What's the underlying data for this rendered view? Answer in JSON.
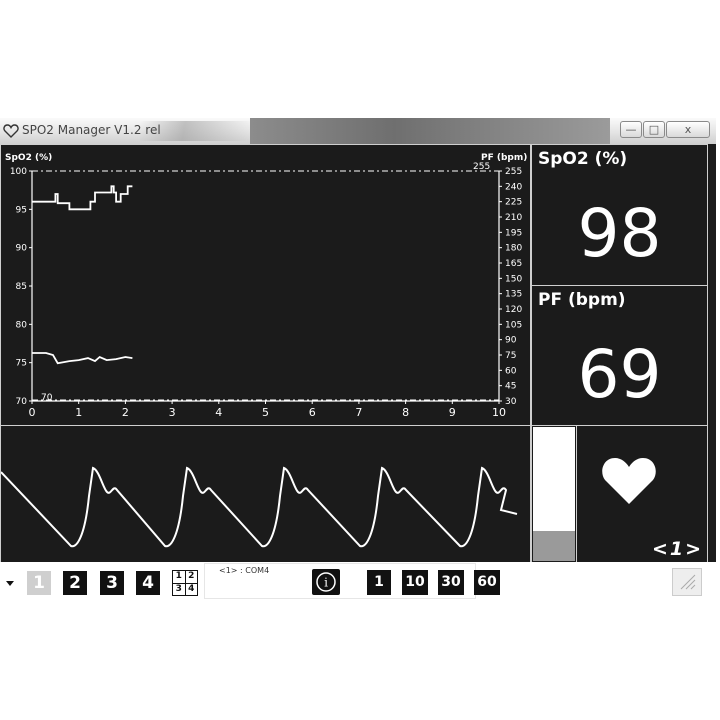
{
  "window": {
    "title": "SPO2 Manager V1.2 rel",
    "minimize_label": "—",
    "maximize_label": "□",
    "close_label": "x"
  },
  "chart_panel": {
    "left_axis_label": "SpO2 (%)",
    "right_axis_label": "PF (bpm)",
    "right_axis_max_marker": "255",
    "left_axis_min_marker": "70"
  },
  "chart_data": {
    "type": "line",
    "x_ticks": [
      0,
      1,
      2,
      3,
      4,
      5,
      6,
      7,
      8,
      9,
      10
    ],
    "xlim": [
      0,
      10
    ],
    "left_axis": {
      "label": "SpO2 (%)",
      "ticks": [
        100,
        95,
        90,
        85,
        80,
        75,
        70
      ],
      "ylim": [
        70,
        100
      ]
    },
    "right_axis": {
      "label": "PF (bpm)",
      "ticks": [
        255,
        240,
        225,
        210,
        195,
        180,
        165,
        150,
        135,
        120,
        105,
        90,
        75,
        60,
        45,
        30
      ],
      "ylim": [
        30,
        255
      ]
    },
    "series": [
      {
        "name": "SpO2 (%)",
        "axis": "left",
        "x": [
          0,
          0.5,
          0.5,
          0.55,
          0.55,
          0.8,
          0.8,
          1.25,
          1.25,
          1.35,
          1.35,
          1.7,
          1.7,
          1.75,
          1.75,
          1.8,
          1.8,
          1.9,
          1.9,
          2.05,
          2.05,
          2.15
        ],
        "y": [
          96,
          96,
          97,
          97,
          95.8,
          95.8,
          95,
          95,
          96,
          96,
          97.2,
          97.2,
          98,
          98,
          97.2,
          97.2,
          96,
          96,
          97,
          97,
          98,
          98
        ]
      },
      {
        "name": "PF (bpm)",
        "axis": "right",
        "x": [
          0,
          0.3,
          0.45,
          0.55,
          0.8,
          1.0,
          1.2,
          1.35,
          1.45,
          1.6,
          1.8,
          2.0,
          2.15
        ],
        "y": [
          77,
          77,
          75,
          67,
          69,
          70,
          72,
          69,
          73,
          70,
          71,
          73,
          72
        ]
      }
    ]
  },
  "spo2_panel": {
    "label": "SpO2 (%)",
    "value": "98"
  },
  "pf_panel": {
    "label": "PF (bpm)",
    "value": "69"
  },
  "signal_bar": {
    "level_fraction": 0.22
  },
  "heart_panel": {
    "icon": "heart-icon",
    "channel_label": "<1>"
  },
  "toolbar": {
    "layout_buttons": [
      "1",
      "2",
      "3",
      "4"
    ],
    "quad_layout_digits": [
      "1",
      "2",
      "3",
      "4"
    ],
    "status_text": "<1> : COM4",
    "info_label": "i",
    "time_buttons": [
      "1",
      "10",
      "30",
      "60"
    ]
  }
}
